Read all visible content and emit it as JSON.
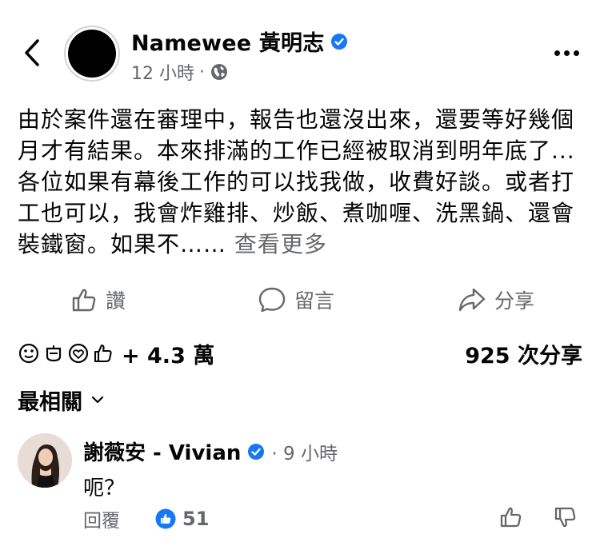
{
  "header": {
    "author": "Namewee 黃明志",
    "time": "12 小時",
    "separator": "·"
  },
  "post": {
    "text": "由於案件還在審理中，報告也還沒出來，還要等好幾個月才有結果。本來排滿的工作已經被取消到明年底了... 各位如果有幕後工作的可以找我做，收費好談。或者打工也可以，我會炸雞排、炒飯、煮咖喱、洗黑鍋、還會裝鐵窗。如果不……",
    "see_more": "查看更多"
  },
  "actions": {
    "like": "讚",
    "comment": "留言",
    "share": "分享"
  },
  "stats": {
    "reaction_count": "+ 4.3 萬",
    "share_count": "925 次分享"
  },
  "sort": {
    "label": "最相關"
  },
  "comment": {
    "author": "謝薇安 - Vivian",
    "time": "· 9 小時",
    "text": "呃？",
    "reply": "回覆",
    "likes": "51"
  },
  "colors": {
    "verified": "#1877f2",
    "secondary_text": "#65676b",
    "like_badge": "#1877f2"
  },
  "icons": [
    "back-arrow-icon",
    "verified-icon",
    "globe-icon",
    "more-icon",
    "like-icon",
    "comment-icon",
    "share-icon",
    "chevron-down-icon",
    "thumbs-up-icon",
    "thumbs-down-icon"
  ]
}
